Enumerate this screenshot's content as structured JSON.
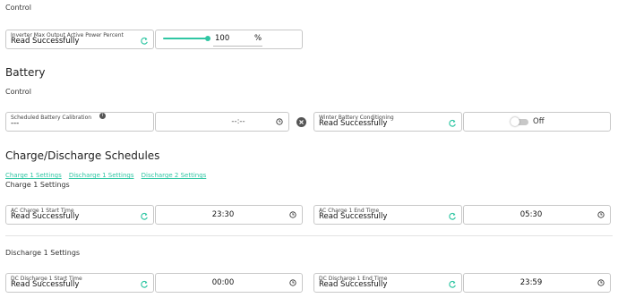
{
  "control_top": "Control",
  "inverter": {
    "label": "Inverter Max Output Active Power Percent",
    "status": "Read Successfully",
    "value": "100",
    "unit": "%",
    "slider_percent": 100
  },
  "battery": {
    "title": "Battery",
    "control_label": "Control",
    "calibration": {
      "label": "Scheduled Battery Calibration",
      "value": "---",
      "time_placeholder": "--:--"
    },
    "winter": {
      "label": "Winter Battery Conditioning",
      "status": "Read Successfully",
      "toggle_label": "Off"
    }
  },
  "schedules": {
    "title": "Charge/Discharge Schedules",
    "links": [
      "Charge 1 Settings",
      "Discharge 1 Settings",
      "Discharge 2 Settings"
    ],
    "charge1": {
      "title": "Charge 1 Settings",
      "start": {
        "label": "AC Charge 1 Start Time",
        "status": "Read Successfully",
        "time": "23:30"
      },
      "end": {
        "label": "AC Charge 1 End Time",
        "status": "Read Successfully",
        "time": "05:30"
      }
    },
    "discharge1": {
      "title": "Discharge 1 Settings",
      "start": {
        "label": "DC Discharge 1 Start Time",
        "status": "Read Successfully",
        "time": "00:00"
      },
      "end": {
        "label": "DC Discharge 1 End Time",
        "status": "Read Successfully",
        "time": "23:59"
      }
    }
  },
  "colors": {
    "accent": "#2fc6a3",
    "border": "#c8c8c8"
  }
}
